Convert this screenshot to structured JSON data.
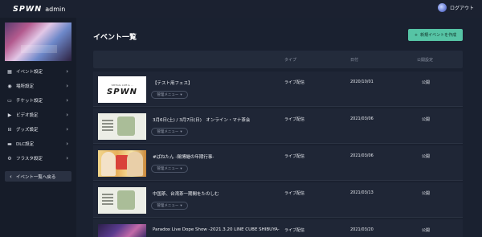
{
  "header": {
    "logo": "SPWN",
    "admin_label": "admin",
    "logout_label": "ログアウト"
  },
  "sidebar": {
    "items": [
      {
        "label": "イベント設定",
        "icon": "calendar-icon",
        "glyph": "▦"
      },
      {
        "label": "場所設定",
        "icon": "location-pin-icon",
        "glyph": "◉"
      },
      {
        "label": "チケット設定",
        "icon": "ticket-icon",
        "glyph": "▭"
      },
      {
        "label": "ビデオ設定",
        "icon": "video-icon",
        "glyph": "▶"
      },
      {
        "label": "グッズ設定",
        "icon": "cart-icon",
        "glyph": "⊟"
      },
      {
        "label": "DLC設定",
        "icon": "download-icon",
        "glyph": "▬"
      },
      {
        "label": "フラスタ設定",
        "icon": "gear-icon",
        "glyph": "⚙"
      }
    ],
    "back_label": "イベント一覧へ戻る"
  },
  "main": {
    "title": "イベント一覧",
    "create_button": "新規イベントを作成",
    "columns": [
      "タイプ",
      "日付",
      "公開設定"
    ],
    "manage_label": "管理メニュー",
    "events": [
      {
        "title": "【テスト用フェス】",
        "type": "ライブ配信",
        "date": "2020/10/01",
        "status": "公開",
        "thumb": "spwn"
      },
      {
        "title": "3月6日(土) / 3月7日(日)　オンライン・マナ茶会",
        "type": "ライブ配信",
        "date": "2021/03/06",
        "status": "公開",
        "thumb": "tea"
      },
      {
        "title": "#ばねたん -鶏博継の年期行事-",
        "type": "ライブ配信",
        "date": "2021/03/06",
        "status": "公開",
        "thumb": "anime"
      },
      {
        "title": "中国茶、台湾茶一期間をたのしむ",
        "type": "ライブ配信",
        "date": "2021/03/13",
        "status": "公開",
        "thumb": "tea"
      },
      {
        "title": "Paradox Live Dope Show -2021.3.20 LINE CUBE SHIBUYA-",
        "type": "ライブ配信",
        "date": "2021/03/20",
        "status": "公開",
        "thumb": "dope"
      }
    ],
    "thumb_texts": {
      "spwn_sub": "VIRTUAL LIVE & ...",
      "spwn_main": "SPWN"
    }
  },
  "colors": {
    "background": "#1a2130",
    "sidebar": "#161c29",
    "accent": "#56c4a5",
    "row": "#1f2636"
  }
}
